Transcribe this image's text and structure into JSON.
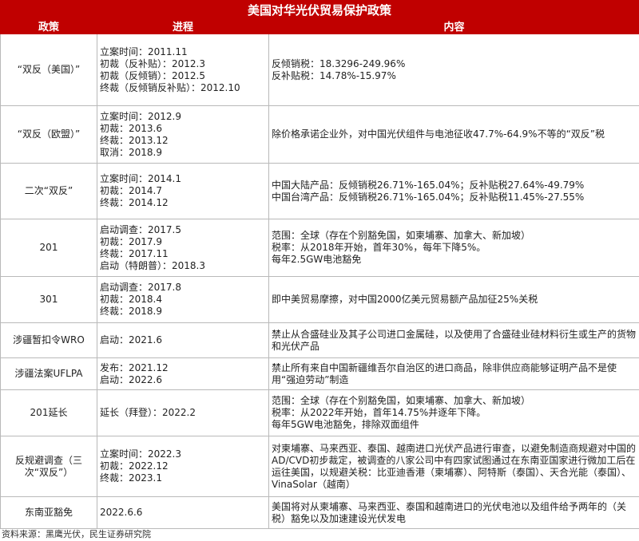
{
  "title": "美国对华光伏贸易保护政策",
  "headers": [
    "政策",
    "进程",
    "内容"
  ],
  "rows": [
    {
      "policy": "“双反（美国）”",
      "progress": [
        "立案时间：2011.11",
        "初裁（反补贴）：2012.3",
        "初裁（反倾销）：2012.5",
        "终裁（反倾销反补贴）：2012.10"
      ],
      "content": [
        "反倾销税：18.3296-249.96%",
        "反补贴税：14.78%-15.97%"
      ]
    },
    {
      "policy": "“双反（欧盟）”",
      "progress": [
        "立案时间：2012.9",
        "初裁：2013.6",
        "终裁：2013.12",
        "取消：2018.9"
      ],
      "content": [
        "除价格承诺企业外，对中国光伏组件与电池征收47.7%-64.9%不等的“双反”税"
      ]
    },
    {
      "policy": "二次“双反”",
      "progress": [
        "立案时间：2014.1",
        "初裁：2014.7",
        "终裁：2014.12"
      ],
      "content": [
        "中国大陆产品：反倾销税26.71%-165.04%；反补贴税27.64%-49.79%",
        "中国台湾产品：反倾销税26.71%-165.04%；反补贴税11.45%-27.55%"
      ]
    },
    {
      "policy": "201",
      "progress": [
        "启动调查：2017.5",
        "初裁：2017.9",
        "终裁：2017.11",
        "启动（特朗普）：2018.3"
      ],
      "content": [
        "范围：全球（存在个别豁免国，如柬埔寨、加拿大、新加坡）",
        "税率：从2018年开始，首年30%，每年下降5%。",
        "每年2.5GW电池豁免"
      ]
    },
    {
      "policy": "301",
      "progress": [
        "启动调查：2017.8",
        "初裁：2018.4",
        "终裁：2018.9"
      ],
      "content": [
        "即中美贸易摩擦，对中国2000亿美元贸易额产品加征25%关税"
      ]
    },
    {
      "policy": "涉疆暂扣令WRO",
      "progress": [
        "启动：2021.6"
      ],
      "content": [
        "禁止从合盛硅业及其子公司进口金属硅，以及使用了合盛硅业硅材料衍生或生产的货物和光伏产品"
      ]
    },
    {
      "policy": "涉疆法案UFLPA",
      "progress": [
        "发布：2021.12",
        "启动：2022.6"
      ],
      "content": [
        "禁止所有来自中国新疆维吾尔自治区的进口商品，除非供应商能够证明产品不是使用“强迫劳动”制造"
      ]
    },
    {
      "policy": "201延长",
      "progress": [
        "延长（拜登）：2022.2"
      ],
      "content": [
        "范围：全球（存在个别豁免国，如柬埔寨、加拿大、新加坡）",
        "税率：从2022年开始，首年14.75%并逐年下降。",
        "每年5GW电池豁免，排除双面组件"
      ]
    },
    {
      "policy": "反规避调查（三次“双反”）",
      "progress": [
        "立案时间：2022.3",
        "初裁：2022.12",
        "终裁：2023.1"
      ],
      "content": [
        "对柬埔寨、马来西亚、泰国、越南进口光伏产品进行审查，以避免制造商规避对中国的AD/CVD初步裁定，被调查的八家公司中有四家试图通过在东南亚国家进行微加工后在运往美国，以规避关税：比亚迪香港（柬埔寨）、阿特斯（泰国）、天合光能（泰国）、VinaSolar（越南）"
      ]
    },
    {
      "policy": "东南亚豁免",
      "progress": [
        "2022.6.6"
      ],
      "content": [
        "美国将对从柬埔寨、马来西亚、泰国和越南进口的光伏电池以及组件给予两年的（关税）豁免以及加速建设光伏发电"
      ]
    }
  ],
  "source": "资料来源：黑鹰光伏，民生证券研究院"
}
